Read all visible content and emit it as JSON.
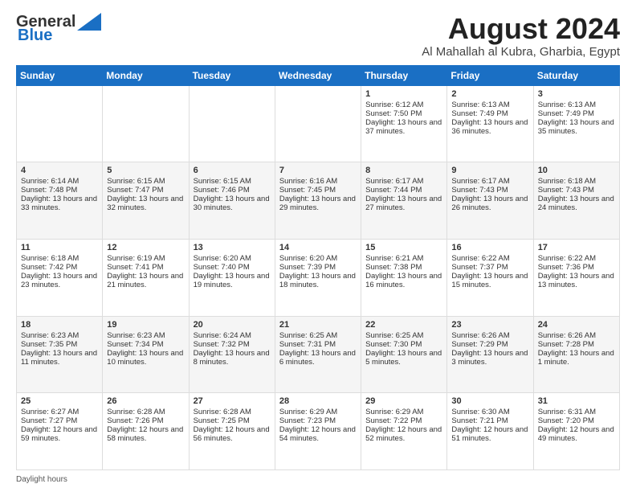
{
  "logo": {
    "line1": "General",
    "line2": "Blue"
  },
  "title": "August 2024",
  "subtitle": "Al Mahallah al Kubra, Gharbia, Egypt",
  "days_of_week": [
    "Sunday",
    "Monday",
    "Tuesday",
    "Wednesday",
    "Thursday",
    "Friday",
    "Saturday"
  ],
  "weeks": [
    [
      {
        "day": "",
        "info": ""
      },
      {
        "day": "",
        "info": ""
      },
      {
        "day": "",
        "info": ""
      },
      {
        "day": "",
        "info": ""
      },
      {
        "day": "1",
        "info": "Sunrise: 6:12 AM\nSunset: 7:50 PM\nDaylight: 13 hours and 37 minutes."
      },
      {
        "day": "2",
        "info": "Sunrise: 6:13 AM\nSunset: 7:49 PM\nDaylight: 13 hours and 36 minutes."
      },
      {
        "day": "3",
        "info": "Sunrise: 6:13 AM\nSunset: 7:49 PM\nDaylight: 13 hours and 35 minutes."
      }
    ],
    [
      {
        "day": "4",
        "info": "Sunrise: 6:14 AM\nSunset: 7:48 PM\nDaylight: 13 hours and 33 minutes."
      },
      {
        "day": "5",
        "info": "Sunrise: 6:15 AM\nSunset: 7:47 PM\nDaylight: 13 hours and 32 minutes."
      },
      {
        "day": "6",
        "info": "Sunrise: 6:15 AM\nSunset: 7:46 PM\nDaylight: 13 hours and 30 minutes."
      },
      {
        "day": "7",
        "info": "Sunrise: 6:16 AM\nSunset: 7:45 PM\nDaylight: 13 hours and 29 minutes."
      },
      {
        "day": "8",
        "info": "Sunrise: 6:17 AM\nSunset: 7:44 PM\nDaylight: 13 hours and 27 minutes."
      },
      {
        "day": "9",
        "info": "Sunrise: 6:17 AM\nSunset: 7:43 PM\nDaylight: 13 hours and 26 minutes."
      },
      {
        "day": "10",
        "info": "Sunrise: 6:18 AM\nSunset: 7:43 PM\nDaylight: 13 hours and 24 minutes."
      }
    ],
    [
      {
        "day": "11",
        "info": "Sunrise: 6:18 AM\nSunset: 7:42 PM\nDaylight: 13 hours and 23 minutes."
      },
      {
        "day": "12",
        "info": "Sunrise: 6:19 AM\nSunset: 7:41 PM\nDaylight: 13 hours and 21 minutes."
      },
      {
        "day": "13",
        "info": "Sunrise: 6:20 AM\nSunset: 7:40 PM\nDaylight: 13 hours and 19 minutes."
      },
      {
        "day": "14",
        "info": "Sunrise: 6:20 AM\nSunset: 7:39 PM\nDaylight: 13 hours and 18 minutes."
      },
      {
        "day": "15",
        "info": "Sunrise: 6:21 AM\nSunset: 7:38 PM\nDaylight: 13 hours and 16 minutes."
      },
      {
        "day": "16",
        "info": "Sunrise: 6:22 AM\nSunset: 7:37 PM\nDaylight: 13 hours and 15 minutes."
      },
      {
        "day": "17",
        "info": "Sunrise: 6:22 AM\nSunset: 7:36 PM\nDaylight: 13 hours and 13 minutes."
      }
    ],
    [
      {
        "day": "18",
        "info": "Sunrise: 6:23 AM\nSunset: 7:35 PM\nDaylight: 13 hours and 11 minutes."
      },
      {
        "day": "19",
        "info": "Sunrise: 6:23 AM\nSunset: 7:34 PM\nDaylight: 13 hours and 10 minutes."
      },
      {
        "day": "20",
        "info": "Sunrise: 6:24 AM\nSunset: 7:32 PM\nDaylight: 13 hours and 8 minutes."
      },
      {
        "day": "21",
        "info": "Sunrise: 6:25 AM\nSunset: 7:31 PM\nDaylight: 13 hours and 6 minutes."
      },
      {
        "day": "22",
        "info": "Sunrise: 6:25 AM\nSunset: 7:30 PM\nDaylight: 13 hours and 5 minutes."
      },
      {
        "day": "23",
        "info": "Sunrise: 6:26 AM\nSunset: 7:29 PM\nDaylight: 13 hours and 3 minutes."
      },
      {
        "day": "24",
        "info": "Sunrise: 6:26 AM\nSunset: 7:28 PM\nDaylight: 13 hours and 1 minute."
      }
    ],
    [
      {
        "day": "25",
        "info": "Sunrise: 6:27 AM\nSunset: 7:27 PM\nDaylight: 12 hours and 59 minutes."
      },
      {
        "day": "26",
        "info": "Sunrise: 6:28 AM\nSunset: 7:26 PM\nDaylight: 12 hours and 58 minutes."
      },
      {
        "day": "27",
        "info": "Sunrise: 6:28 AM\nSunset: 7:25 PM\nDaylight: 12 hours and 56 minutes."
      },
      {
        "day": "28",
        "info": "Sunrise: 6:29 AM\nSunset: 7:23 PM\nDaylight: 12 hours and 54 minutes."
      },
      {
        "day": "29",
        "info": "Sunrise: 6:29 AM\nSunset: 7:22 PM\nDaylight: 12 hours and 52 minutes."
      },
      {
        "day": "30",
        "info": "Sunrise: 6:30 AM\nSunset: 7:21 PM\nDaylight: 12 hours and 51 minutes."
      },
      {
        "day": "31",
        "info": "Sunrise: 6:31 AM\nSunset: 7:20 PM\nDaylight: 12 hours and 49 minutes."
      }
    ]
  ],
  "footer": {
    "daylight_label": "Daylight hours"
  }
}
